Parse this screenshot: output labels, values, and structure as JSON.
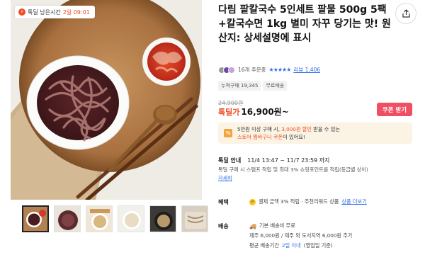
{
  "deal_badge": {
    "label": "톡딜 남은시간",
    "time": "2일 09:01"
  },
  "product": {
    "title": "다림 팥칼국수 5인세트 팥물 500g 5팩+칼국수면 1kg 별미 자꾸 당기는 맛! 원산지: 상세설명에 표시",
    "order_count": "16개 주문중",
    "stars": "★★★★★",
    "review_label": "리뷰 1,406",
    "tags": [
      "누적구매 19,345",
      "무료배송"
    ],
    "original_price": "24,900원",
    "price_label": "톡딜가",
    "price": "16,900원~",
    "coupon_button": "쿠폰 받기"
  },
  "promo": {
    "icon": "%",
    "line1_a": "5만원 이상 구매 시, ",
    "line1_hl": "3,000원 할인",
    "line1_b": " 받을 수 있는",
    "line2_hl": "스토어 찜바구니 쿠폰",
    "line2_b": "이 있어요!"
  },
  "deal_info": {
    "label": "톡딜 안내",
    "period": "11/4 13:47 ~ 11/7 23:59 까지",
    "desc": "톡딜 구매 시 스탬프 적립 및 최대 3% 쇼핑포인트를 적립(등급별 상이)",
    "more": "자세히"
  },
  "benefit": {
    "label": "혜택",
    "text": "결제 금액 3% 적립 · 추천리워드 상품",
    "link": "상품 더보기"
  },
  "shipping": {
    "label": "배송",
    "line1": "기본 배송비 무료",
    "line2": "제주 6,000원 / 제주 외 도서지역 6,000원 추가",
    "line3_a": "평균 배송기간 ",
    "line3_hl": "2일 이내",
    "line3_b": " (영업일 기준)"
  },
  "colors": {
    "accent": "#f04b23",
    "coupon": "#f04e62",
    "link": "#2d6fe8",
    "promo_bg": "#fbf3e4"
  },
  "icons": {
    "share": "share-icon",
    "bolt": "lightning-icon",
    "coin": "point-coin-icon",
    "truck": "truck-icon"
  }
}
